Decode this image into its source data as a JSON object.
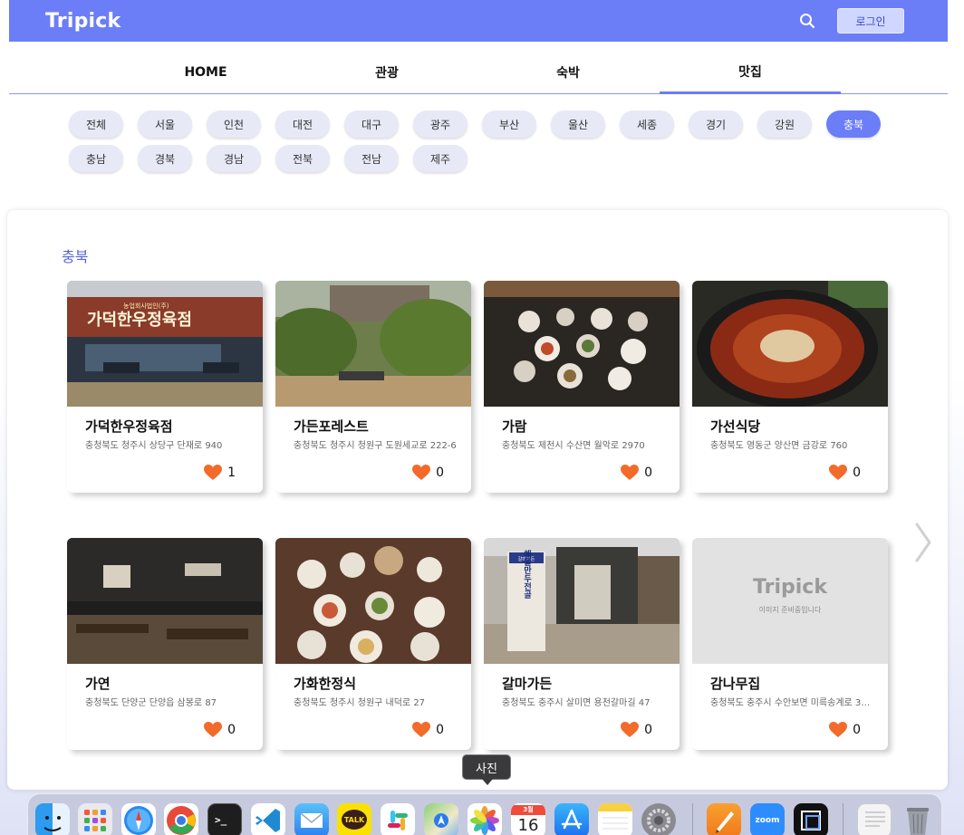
{
  "header": {
    "logo": "Tripick",
    "login_label": "로그인"
  },
  "nav": {
    "tabs": [
      {
        "label": "HOME"
      },
      {
        "label": "관광"
      },
      {
        "label": "숙박"
      },
      {
        "label": "맛집"
      }
    ],
    "active_index": 3
  },
  "regions": {
    "chips": [
      "전체",
      "서울",
      "인천",
      "대전",
      "대구",
      "광주",
      "부산",
      "울산",
      "세종",
      "경기",
      "강원",
      "충북",
      "충남",
      "경북",
      "경남",
      "전북",
      "전남",
      "제주"
    ],
    "active": "충북"
  },
  "section": {
    "title": "충북"
  },
  "restaurants": [
    {
      "name": "가덕한우정육점",
      "address": "충청북도 청주시 상당구 단재로 940",
      "likes": "1",
      "image_alt": "가덕한우정육점"
    },
    {
      "name": "가든포레스트",
      "address": "충청북도 청주시 청원구 도원세교로 222-6",
      "likes": "0",
      "image_alt": "가든포레스트"
    },
    {
      "name": "가람",
      "address": "충청북도 제천시 수산면 월악로 2970",
      "likes": "0",
      "image_alt": "가람"
    },
    {
      "name": "가선식당",
      "address": "충청북도 영동군 양산면 금강로 760",
      "likes": "0",
      "image_alt": "가선식당"
    },
    {
      "name": "가연",
      "address": "충청북도 단양군 단양읍 삼봉로 87",
      "likes": "0",
      "image_alt": "가연"
    },
    {
      "name": "가화한정식",
      "address": "충청북도 청주시 청원구 내덕로 27",
      "likes": "0",
      "image_alt": "가화한정식"
    },
    {
      "name": "갈마가든",
      "address": "충청북도 충주시 살미면 용천갈마길 47",
      "likes": "0",
      "image_alt": "갈마가든"
    },
    {
      "name": "감나무집",
      "address": "충청북도 충주시 수안보면 미륵송계로 3…",
      "likes": "0",
      "image_alt": "감나무집"
    }
  ],
  "placeholder_image": {
    "logo": "Tripick",
    "text": "이미지 준비중입니다"
  },
  "sign_text": {
    "storefront": "가덕한우정육점",
    "storefront_top": "농업회사법인(주)",
    "gamma_banner": "해물만두전골"
  },
  "tooltip": {
    "label": "사진"
  },
  "dock": {
    "calendar_month": "3월",
    "calendar_day": "16",
    "apps": [
      "finder",
      "launchpad",
      "safari",
      "chrome",
      "terminal",
      "vscode",
      "mail",
      "kakaotalk",
      "slack",
      "maps",
      "photos",
      "calendar",
      "app-store",
      "notes",
      "system-settings",
      "pages",
      "zoom",
      "screenshot",
      "preview",
      "trash"
    ],
    "kakao_label": "TALK",
    "zoom_label": "zoom"
  },
  "colors": {
    "accent": "#6b7df7",
    "heart": "#f26b2a"
  }
}
